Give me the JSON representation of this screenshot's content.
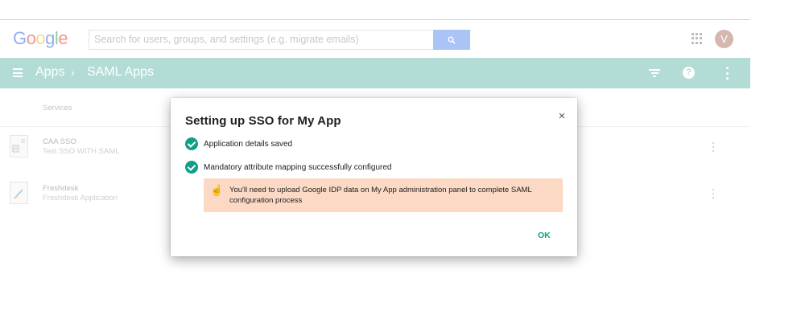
{
  "header": {
    "logo_letters": [
      {
        "char": "G",
        "color": "#90aef5"
      },
      {
        "char": "o",
        "color": "#f4958c"
      },
      {
        "char": "o",
        "color": "#f8d98c"
      },
      {
        "char": "g",
        "color": "#90aef5"
      },
      {
        "char": "l",
        "color": "#8fd0a5"
      },
      {
        "char": "e",
        "color": "#f4958c"
      }
    ],
    "search_placeholder": "Search for users, groups, and settings (e.g. migrate emails)",
    "avatar_initial": "V"
  },
  "appbar": {
    "crumb_apps": "Apps",
    "crumb_separator": "›",
    "crumb_saml": "SAML Apps",
    "help_glyph": "?"
  },
  "list": {
    "column_header": "Services",
    "rows": [
      {
        "name": "CAA SSO",
        "description": "Test SSO WITH SAML"
      },
      {
        "name": "Freshdesk",
        "description": "Freshdesk Application"
      }
    ]
  },
  "dialog": {
    "title": "Setting up SSO for My App",
    "close_glyph": "×",
    "status_items": [
      {
        "text": "Application details saved"
      },
      {
        "text": "Mandatory attribute mapping successfully configured"
      }
    ],
    "notice_icon_glyph": "☝",
    "notice_text": "You'll need to upload Google IDP data on My App administration panel to complete SAML configuration process",
    "ok_label": "OK"
  },
  "colors": {
    "appbar": "#b3dcd6",
    "accent": "#129d85",
    "notice_bg": "#fcd9c5"
  }
}
